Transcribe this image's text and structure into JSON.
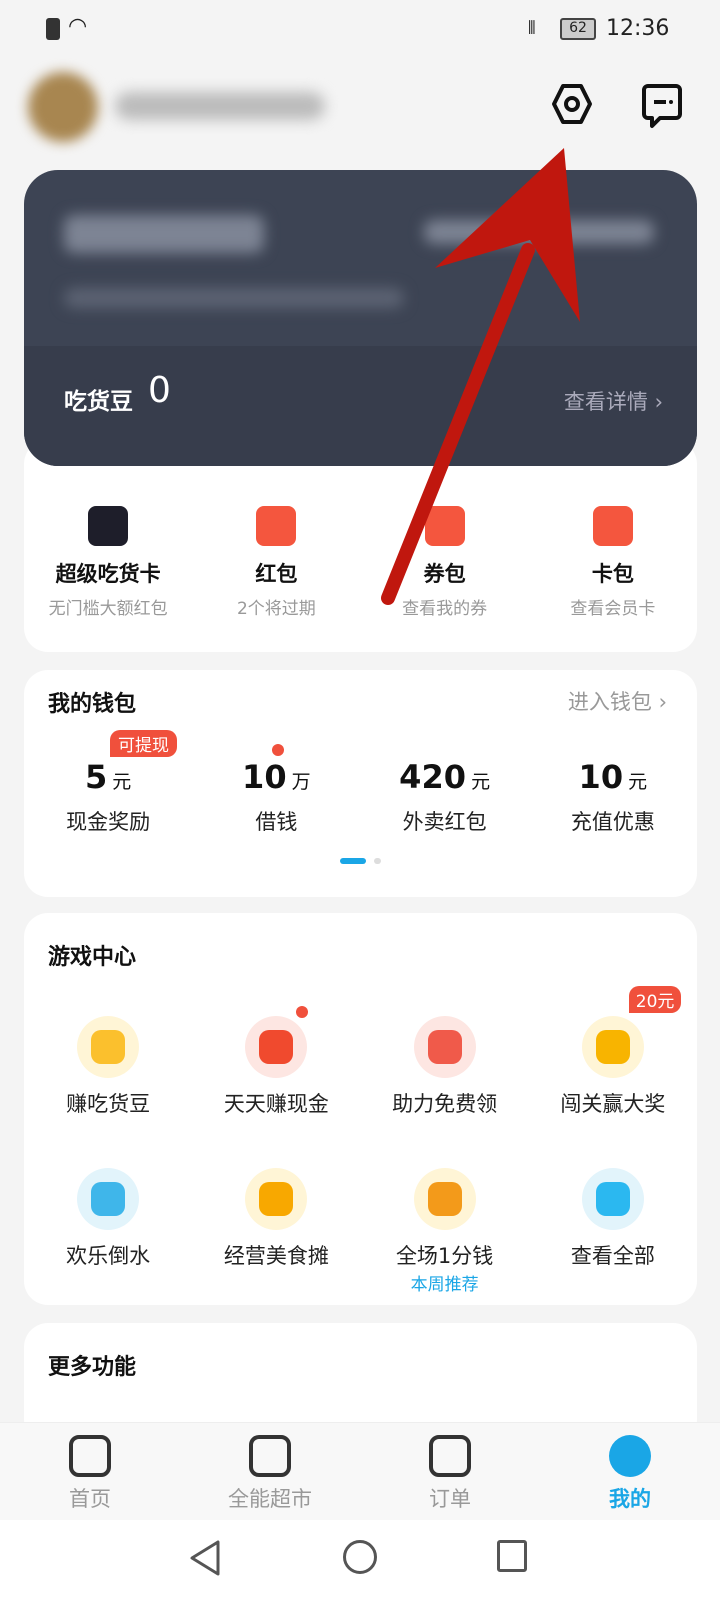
{
  "status_bar": {
    "time": "12:36",
    "battery": "62"
  },
  "header": {
    "settings_icon": "hexagon-settings-icon",
    "message_icon": "message-icon"
  },
  "member_card": {
    "beans_label": "吃货豆",
    "beans_value": "0",
    "details_link": "查看详情"
  },
  "shortcuts": [
    {
      "title": "超级吃货卡",
      "subtitle": "无门槛大额红包",
      "color": "#1e1e2a"
    },
    {
      "title": "红包",
      "subtitle": "2个将过期",
      "color": "#f4563e"
    },
    {
      "title": "券包",
      "subtitle": "查看我的券",
      "color": "#f4563e"
    },
    {
      "title": "卡包",
      "subtitle": "查看会员卡",
      "color": "#f4563e"
    }
  ],
  "wallet": {
    "title": "我的钱包",
    "link": "进入钱包",
    "badge": "可提现",
    "items": [
      {
        "value": "5",
        "unit": "元",
        "label": "现金奖励"
      },
      {
        "value": "10",
        "unit": "万",
        "label": "借钱"
      },
      {
        "value": "420",
        "unit": "元",
        "label": "外卖红包"
      },
      {
        "value": "10",
        "unit": "元",
        "label": "充值优惠"
      }
    ]
  },
  "game_center": {
    "title": "游戏中心",
    "items": [
      {
        "label": "赚吃货豆",
        "color": "#fbc02d",
        "bg": "#fff5d6"
      },
      {
        "label": "天天赚现金",
        "color": "#f04a2e",
        "bg": "#fde6e2"
      },
      {
        "label": "助力免费领",
        "color": "#f05a4a",
        "bg": "#fde6e2"
      },
      {
        "label": "闯关赢大奖",
        "color": "#f8b400",
        "bg": "#fff5d6",
        "badge": "20元"
      },
      {
        "label": "欢乐倒水",
        "color": "#3fb6ea",
        "bg": "#e2f4fb"
      },
      {
        "label": "经营美食摊",
        "color": "#f8a800",
        "bg": "#fff5d6"
      },
      {
        "label": "全场1分钱",
        "color": "#f39a1a",
        "bg": "#fff5d6",
        "note": "本周推荐"
      },
      {
        "label": "查看全部",
        "color": "#2bb8f0",
        "bg": "#e2f4fb"
      }
    ]
  },
  "more": {
    "title": "更多功能"
  },
  "bottom_nav": [
    {
      "label": "首页"
    },
    {
      "label": "全能超市"
    },
    {
      "label": "订单"
    },
    {
      "label": "我的",
      "active": true
    }
  ],
  "accent": "#1aa6e6"
}
